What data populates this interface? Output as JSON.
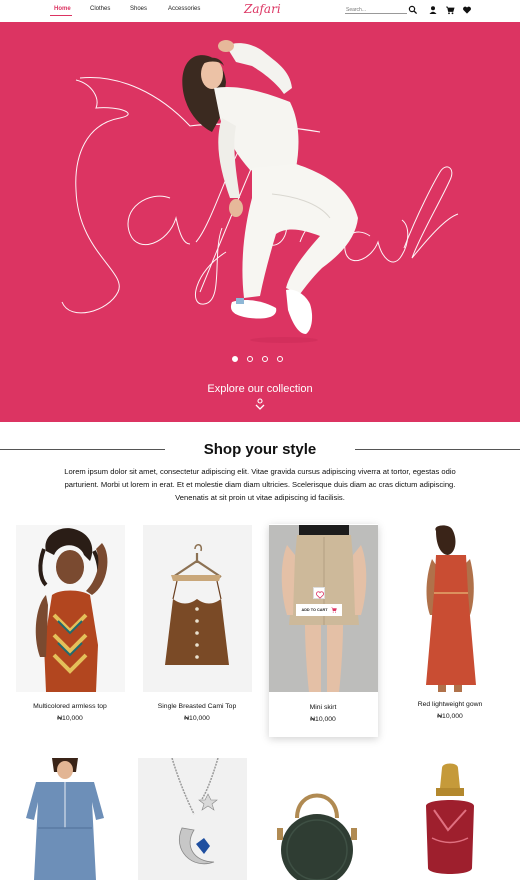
{
  "nav": {
    "links": [
      "Home",
      "Clothes",
      "Shoes",
      "Accessories"
    ],
    "logo": "Zafari",
    "search_placeholder": "Search...",
    "icons": [
      "search-icon",
      "user-icon",
      "cart-icon",
      "heart-icon"
    ]
  },
  "hero": {
    "script_text": "Zafari",
    "slides_total": 4,
    "active_slide": 1,
    "cta": "Explore our collection"
  },
  "section": {
    "title": "Shop your style",
    "description": "Lorem ipsum dolor sit amet, consectetur adipiscing elit. Vitae gravida cursus adipiscing viverra at tortor, egestas odio parturient. Morbi ut lorem in erat. Et et molestie diam diam ultricies. Scelerisque duis diam ac cras dictum adipiscing. Venenatis at sit proin ut vitae adipiscing id facilisis."
  },
  "products": [
    {
      "name": "Multicolored armless top",
      "price": "₦10,000"
    },
    {
      "name": "Single Breasted Cami Top",
      "price": "₦10,000"
    },
    {
      "name": "Mini skirt",
      "price": "₦10,000"
    },
    {
      "name": "Red lightweight gown",
      "price": "₦10,000"
    }
  ],
  "hover_actions": {
    "add_to_cart": "ADD TO CART"
  },
  "colors": {
    "brand": "#dc3462",
    "text": "#111111"
  }
}
